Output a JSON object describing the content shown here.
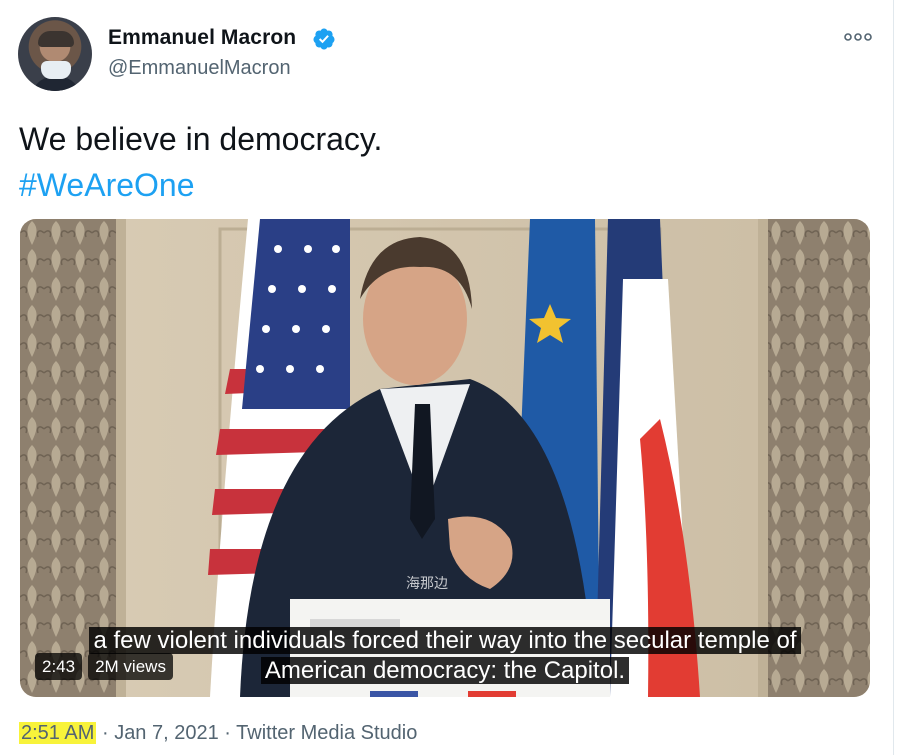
{
  "author": {
    "display_name": "Emmanuel Macron",
    "handle": "@EmmanuelMacron",
    "verified": true
  },
  "tweet": {
    "text": "We believe in democracy.",
    "hashtag": "#WeAreOne"
  },
  "video": {
    "subtitle_line1": "a few violent individuals forced their way into the secular temple of",
    "subtitle_line2": "American democracy: the Capitol.",
    "duration": "2:43",
    "views": "2M views",
    "watermark": "海那边"
  },
  "meta": {
    "time": "2:51 AM",
    "separator1": "·",
    "date": "Jan 7, 2021",
    "separator2": "·",
    "source": "Twitter Media Studio"
  },
  "colors": {
    "accent": "#1da1f2",
    "highlight": "#f8f33a",
    "secondary_text": "#536471"
  },
  "icons": {
    "verified": "verified-badge-icon",
    "more": "more-options-icon"
  }
}
